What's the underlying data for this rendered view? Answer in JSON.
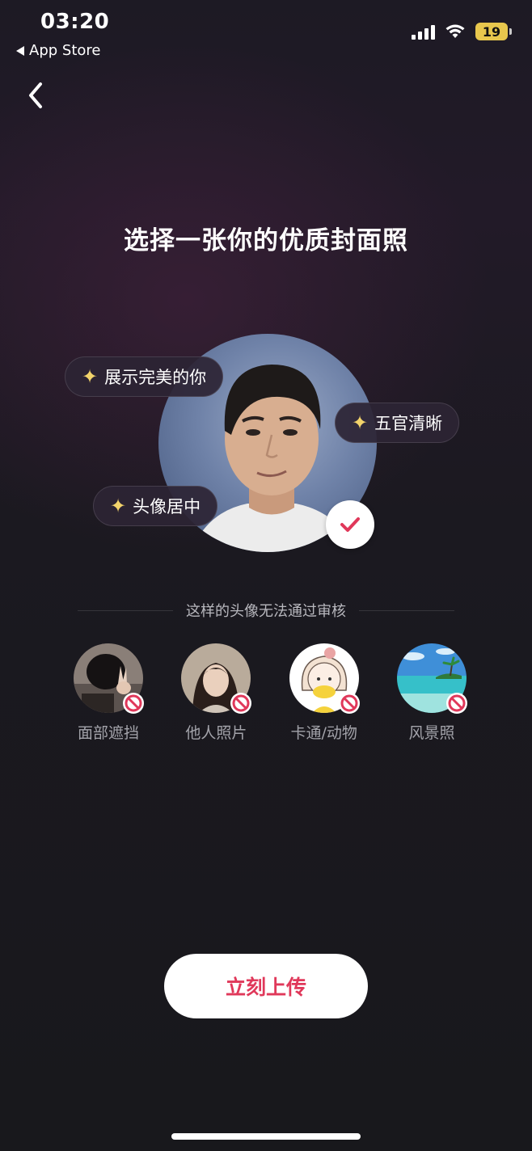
{
  "status_bar": {
    "time": "03:20",
    "back_app": "App Store",
    "battery": "19"
  },
  "page": {
    "title": "选择一张你的优质封面照"
  },
  "tips": [
    {
      "label": "展示完美的你",
      "icon": "sparkle-icon"
    },
    {
      "label": "五官清晰",
      "icon": "sparkle-icon"
    },
    {
      "label": "头像居中",
      "icon": "sparkle-icon"
    }
  ],
  "rejected": {
    "heading": "这样的头像无法通过审核",
    "items": [
      {
        "label": "面部遮挡"
      },
      {
        "label": "他人照片"
      },
      {
        "label": "卡通/动物"
      },
      {
        "label": "风景照"
      }
    ]
  },
  "actions": {
    "upload_label": "立刻上传"
  },
  "colors": {
    "accent": "#e0385a",
    "sparkle": "#f2d36b",
    "battery": "#e8c74d"
  }
}
